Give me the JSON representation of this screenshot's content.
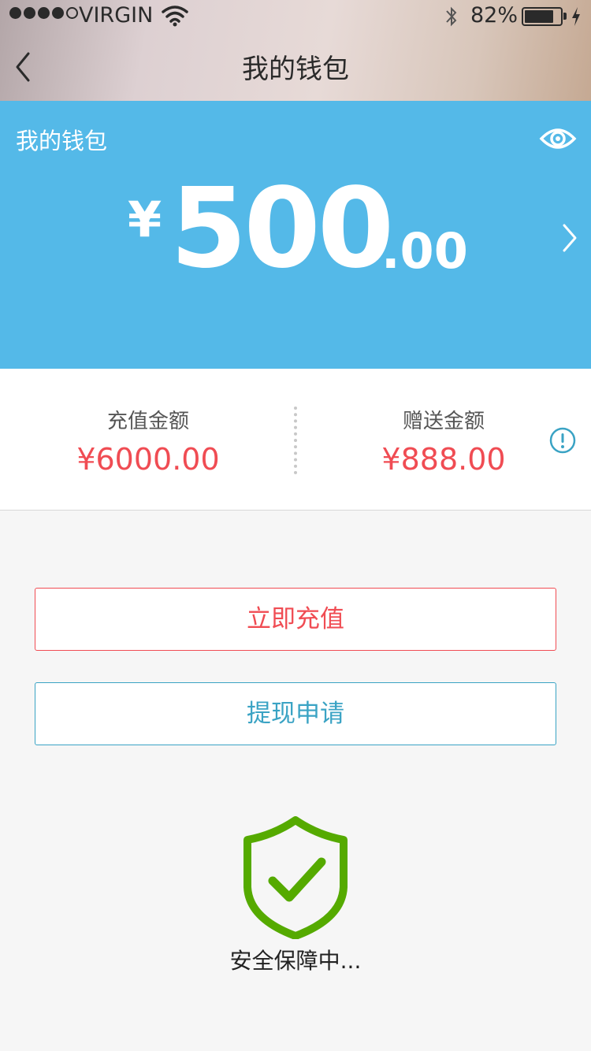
{
  "status_bar": {
    "carrier": "VIRGIN",
    "battery": "82%",
    "battery_level": 0.82
  },
  "nav": {
    "title": "我的钱包"
  },
  "wallet": {
    "label": "我的钱包",
    "currency": "¥",
    "amount_int": "500",
    "amount_dec": ".00"
  },
  "stats": {
    "recharge_label": "充值金额",
    "recharge_value": "¥6000.00",
    "bonus_label": "赠送金额",
    "bonus_value": "¥888.00"
  },
  "actions": {
    "recharge": "立即充值",
    "withdraw": "提现申请"
  },
  "security": {
    "text": "安全保障中..."
  },
  "colors": {
    "card_blue": "#54b9e8",
    "accent_red": "#f04c53",
    "accent_teal": "#3aa3c4",
    "shield_green": "#55aa00"
  },
  "icons": [
    "back-chevron-icon",
    "eye-icon",
    "chevron-right-icon",
    "info-icon",
    "shield-check-icon",
    "wifi-icon",
    "bluetooth-icon",
    "charging-icon"
  ]
}
